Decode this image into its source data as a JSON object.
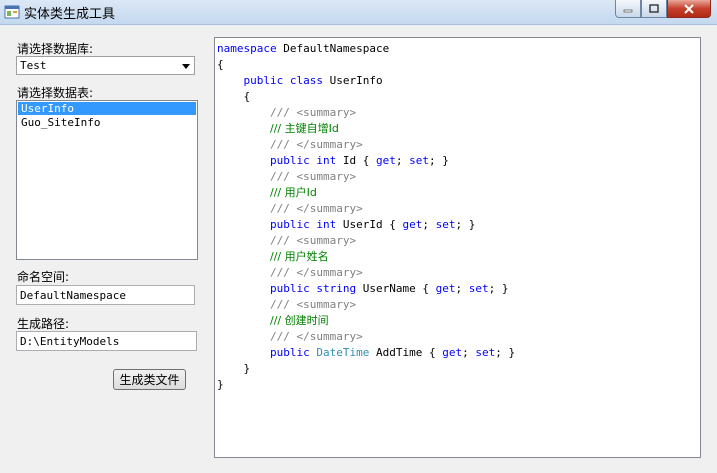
{
  "window": {
    "title": "实体类生成工具"
  },
  "form": {
    "database_label": "请选择数据库:",
    "database_value": "Test",
    "table_label": "请选择数据表:",
    "tables": [
      "UserInfo",
      "Guo_SiteInfo"
    ],
    "namespace_label": "命名空间:",
    "namespace_value": "DefaultNamespace",
    "path_label": "生成路径:",
    "path_value": "D:\\EntityModels",
    "generate_button": "生成类文件"
  },
  "code": {
    "kw_namespace": "namespace",
    "ns_name": " DefaultNamespace",
    "open_brace": "{",
    "close_brace": "}",
    "kw_public": "public",
    "kw_class": " class",
    "class_name": " UserInfo",
    "comment_prefix": "/// ",
    "summary_open": "<summary>",
    "summary_close": "</summary>",
    "kw_int": " int",
    "kw_string": " string",
    "type_datetime": " DateTime",
    "accessor_open": " { ",
    "kw_get": "get",
    "accessor_sep": "; ",
    "kw_set": "set",
    "accessor_close": "; }",
    "properties": [
      {
        "summary": "主键自增Id",
        "name": " Id"
      },
      {
        "summary": "用户Id",
        "name": " UserId"
      },
      {
        "summary": "用户姓名",
        "name": " UserName"
      },
      {
        "summary": "创建时间",
        "name": " AddTime"
      }
    ]
  }
}
